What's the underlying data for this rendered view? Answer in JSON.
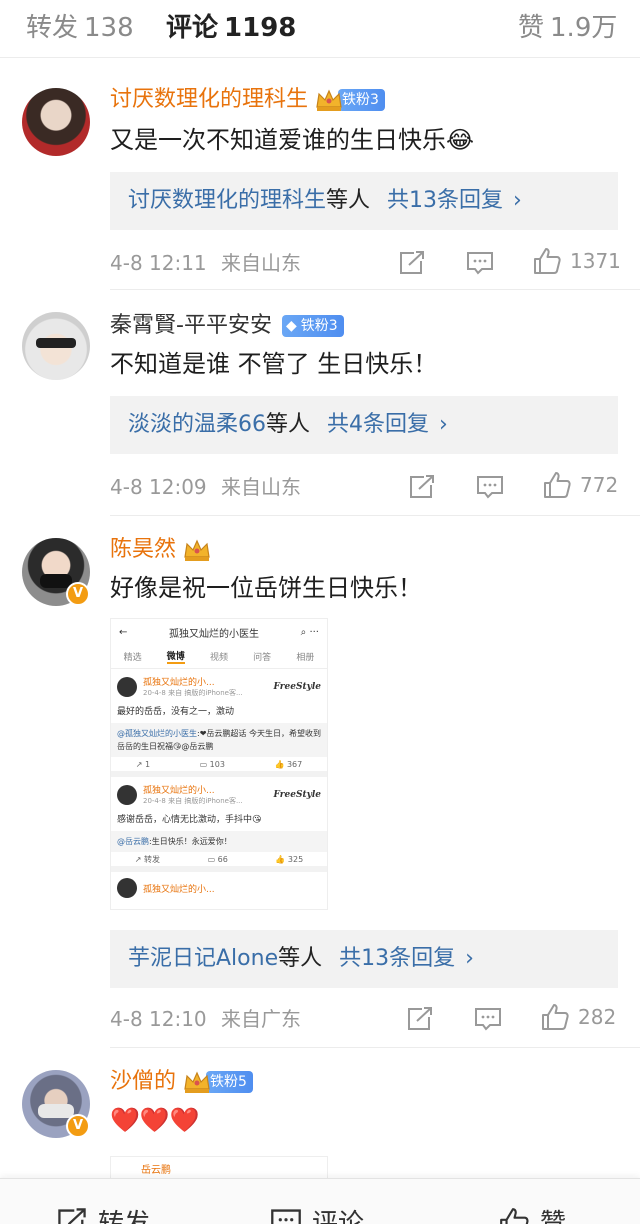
{
  "tabs": [
    {
      "label": "转发",
      "count": "138"
    },
    {
      "label": "评论",
      "count": "1198"
    },
    {
      "label": "赞",
      "count": "1.9万"
    }
  ],
  "comments": [
    {
      "username": "讨厌数理化的理科生",
      "fan_badge": "铁粉3",
      "text": "又是一次不知道爱谁的生日快乐😂",
      "reply_names": "讨厌数理化的理科生",
      "reply_mid": "等人",
      "reply_count": "共13条回复",
      "reply_chevron": "›",
      "time": "4-8 12:11",
      "location": "来自山东",
      "likes": "1371"
    },
    {
      "username": "秦霄賢-平平安安",
      "fan_badge": "铁粉3",
      "text": "不知道是谁 不管了 生日快乐！",
      "reply_names": "淡淡的温柔66",
      "reply_mid": "等人",
      "reply_count": "共4条回复",
      "reply_chevron": "›",
      "time": "4-8 12:09",
      "location": "来自山东",
      "likes": "772"
    },
    {
      "username": "陈昊然",
      "text": "好像是祝一位岳饼生日快乐！",
      "reply_names": "芋泥日记Alone",
      "reply_mid": "等人",
      "reply_count": "共13条回复",
      "reply_chevron": "›",
      "time": "4-8 12:10",
      "location": "来自广东",
      "likes": "282",
      "embedded": {
        "title": "孤独又灿烂的小医生",
        "subtabs": [
          "精选",
          "微博",
          "视频",
          "问答",
          "相册"
        ],
        "posts": [
          {
            "name": "孤独又灿烂的小...",
            "sub": "20-4-8 来自 搞版的iPhone客...",
            "brand": "FreeStyle",
            "text": "最好的岳岳，没有之一，激动",
            "quote_user": "@孤独又灿烂的小医生",
            "quote_text": ":❤岳云鹏超话 今天生日，希望收到岳岳的生日祝福😘@岳云鹏",
            "repost": "1",
            "comments": "103",
            "likes": "367"
          },
          {
            "name": "孤独又灿烂的小...",
            "sub": "20-4-8 来自 搞版的iPhone客...",
            "brand": "FreeStyle",
            "text": "感谢岳岳，心情无比激动，手抖中😘",
            "quote_user": "@岳云鹏",
            "quote_text": ":生日快乐！永远爱你！",
            "repost": "转发",
            "comments": "66",
            "likes": "325"
          }
        ],
        "third_name": "孤独又灿烂的小..."
      }
    },
    {
      "username": "沙僧的",
      "fan_badge": "铁粉5",
      "text": "❤️❤️❤️",
      "preview_name": "岳云鹏"
    }
  ],
  "bottom_bar": {
    "repost": "转发",
    "comment": "评论",
    "like": "赞"
  },
  "colors": {
    "orange_name": "#e8730c",
    "link_blue": "#3a6ea8",
    "badge_blue": "#4f8ef0",
    "meta_gray": "#999999"
  }
}
